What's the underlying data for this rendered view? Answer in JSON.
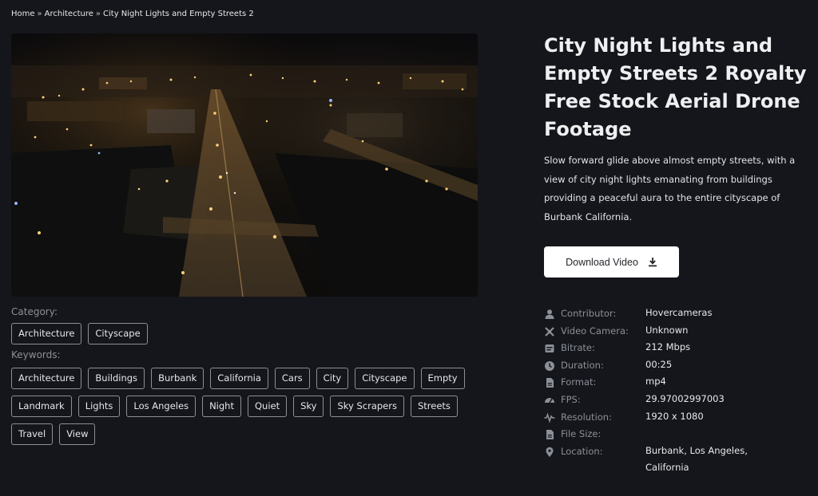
{
  "breadcrumb": {
    "home": "Home",
    "category": "Architecture",
    "current": "City Night Lights and Empty Streets 2",
    "separator": "»"
  },
  "video": {
    "icon": "aerial-night-city-thumbnail"
  },
  "title": "City Night Lights and Empty Streets 2 Royalty Free Stock Aerial Drone Footage",
  "description": "Slow forward glide above almost empty streets, with a view of city night lights emanating from buildings providing a peaceful aura to the entire cityscape of Burbank California.",
  "download": {
    "label": "Download Video",
    "icon": "download-icon"
  },
  "category": {
    "label": "Category:",
    "tags": [
      "Architecture",
      "Cityscape"
    ]
  },
  "keywords": {
    "label": "Keywords:",
    "rows": [
      [
        "Architecture",
        "Buildings",
        "Burbank",
        "California",
        "Cars",
        "City",
        "Cityscape",
        "Empty"
      ],
      [
        "Landmark",
        "Lights",
        "Los Angeles",
        "Night",
        "Quiet",
        "Sky",
        "Sky Scrapers",
        "Streets"
      ],
      [
        "Travel",
        "View"
      ]
    ]
  },
  "meta": [
    {
      "icon": "user-icon",
      "label": "Contributor:",
      "value": "Hovercameras"
    },
    {
      "icon": "video-camera-icon",
      "label": "Video Camera:",
      "value": "Unknown"
    },
    {
      "icon": "bitrate-icon",
      "label": "Bitrate:",
      "value": "212 Mbps"
    },
    {
      "icon": "clock-icon",
      "label": "Duration:",
      "value": "00:25"
    },
    {
      "icon": "file-icon",
      "label": "Format:",
      "value": "mp4"
    },
    {
      "icon": "speedometer-icon",
      "label": "FPS:",
      "value": "29.97002997003"
    },
    {
      "icon": "waveform-icon",
      "label": "Resolution:",
      "value": "1920 x 1080"
    },
    {
      "icon": "file-icon",
      "label": "File Size:",
      "value": ""
    },
    {
      "icon": "location-pin-icon",
      "label": "Location:",
      "value": "Burbank, Los Angeles, California"
    }
  ],
  "colors": {
    "background": "#15161b",
    "tag_border": "#8b8f98",
    "label_gray": "#8b8f98",
    "button_bg": "#ffffff"
  }
}
